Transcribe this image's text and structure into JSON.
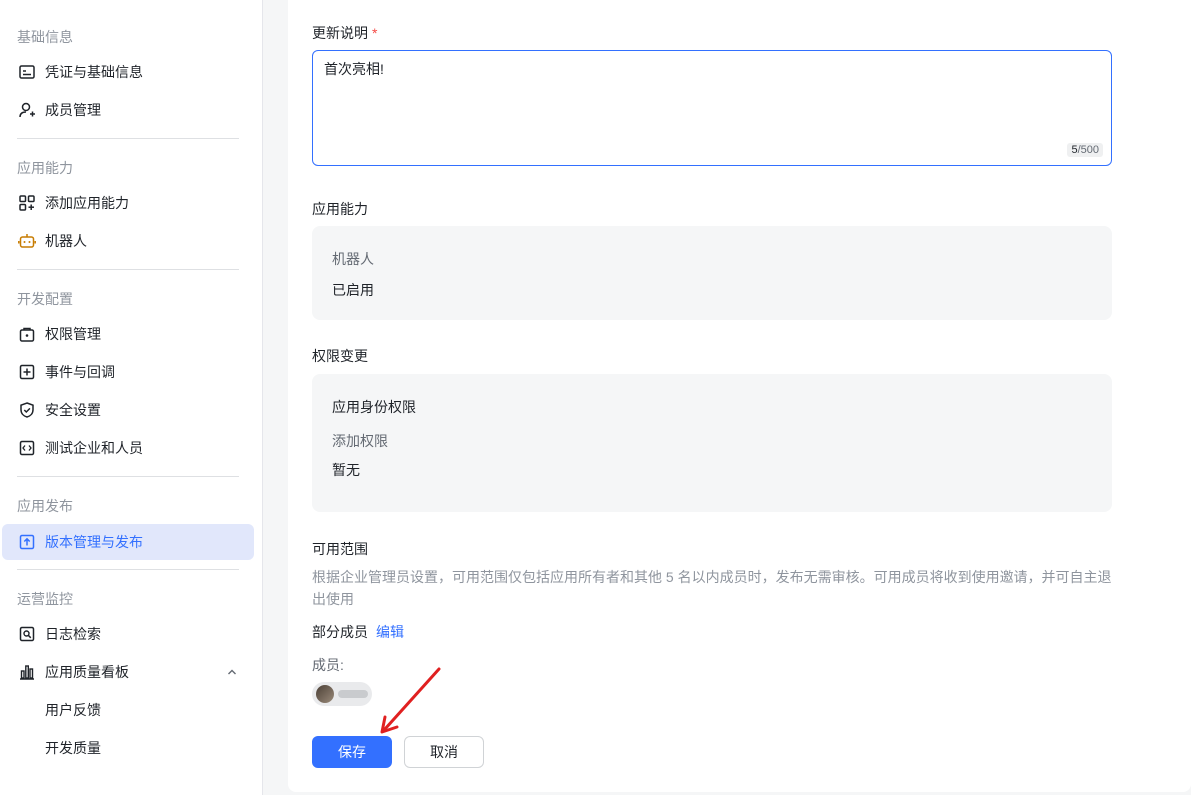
{
  "sidebar": {
    "sections": [
      {
        "title": "基础信息",
        "items": [
          {
            "label": "凭证与基础信息",
            "icon": "id-card-icon"
          },
          {
            "label": "成员管理",
            "icon": "add-member-icon"
          }
        ]
      },
      {
        "title": "应用能力",
        "items": [
          {
            "label": "添加应用能力",
            "icon": "add-app-icon"
          },
          {
            "label": "机器人",
            "icon": "robot-icon"
          }
        ]
      },
      {
        "title": "开发配置",
        "items": [
          {
            "label": "权限管理",
            "icon": "permission-icon"
          },
          {
            "label": "事件与回调",
            "icon": "event-icon"
          },
          {
            "label": "安全设置",
            "icon": "shield-icon"
          },
          {
            "label": "测试企业和人员",
            "icon": "code-icon"
          }
        ]
      },
      {
        "title": "应用发布",
        "items": [
          {
            "label": "版本管理与发布",
            "icon": "upload-icon"
          }
        ]
      },
      {
        "title": "运营监控",
        "items": [
          {
            "label": "日志检索",
            "icon": "log-search-icon"
          },
          {
            "label": "应用质量看板",
            "icon": "bar-chart-icon"
          }
        ],
        "subitems": [
          "用户反馈",
          "开发质量"
        ]
      }
    ],
    "active_item": "版本管理与发布"
  },
  "form": {
    "update_notes": {
      "label": "更新说明",
      "required_mark": "*",
      "value": "首次亮相!",
      "counter_current": "5",
      "counter_max": "/500"
    },
    "capability": {
      "label": "应用能力",
      "name": "机器人",
      "status": "已启用"
    },
    "permission": {
      "label": "权限变更",
      "title": "应用身份权限",
      "subtitle": "添加权限",
      "value": "暂无"
    },
    "scope": {
      "label": "可用范围",
      "description": "根据企业管理员设置，可用范围仅包括应用所有者和其他 5 名以内成员时，发布无需审核。可用成员将收到使用邀请，并可自主退出使用",
      "type": "部分成员",
      "edit_link": "编辑",
      "members_label": "成员:"
    },
    "buttons": {
      "save": "保存",
      "cancel": "取消"
    }
  },
  "colors": {
    "accent": "#3370ff",
    "required": "#f54a45",
    "arrow": "#e02020"
  }
}
